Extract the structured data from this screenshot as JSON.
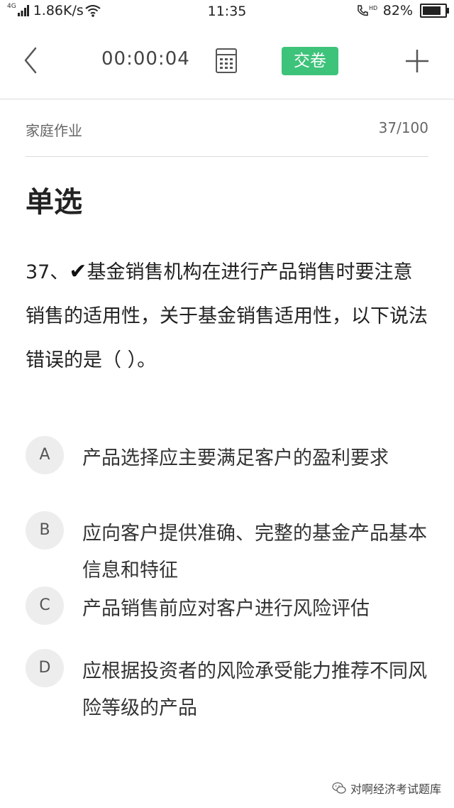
{
  "status_bar": {
    "network": "4G",
    "speed": "1.86K/s",
    "time": "11:35",
    "hd": "HD",
    "battery_text": "82%",
    "battery_level": 0.82
  },
  "toolbar": {
    "timer": "00:00:04",
    "submit_label": "交卷",
    "accent_color": "#3ec37a"
  },
  "sub_header": {
    "section_name": "家庭作业",
    "progress": "37/100"
  },
  "question": {
    "type": "单选",
    "number": "37、",
    "mark": "✔",
    "text": "基金销售机构在进行产品销售时要注意销售的适用性，关于基金销售适用性，以下说法错误的是（ ）。"
  },
  "options": [
    {
      "letter": "A",
      "text": "产品选择应主要满足客户的盈利要求"
    },
    {
      "letter": "B",
      "text": "应向客户提供准确、完整的基金产品基本信息和特征"
    },
    {
      "letter": "C",
      "text": "产品销售前应对客户进行风险评估"
    },
    {
      "letter": "D",
      "text": "应根据投资者的风险承受能力推荐不同风险等级的产品"
    }
  ],
  "watermark": {
    "text": "对啊经济考试题库"
  }
}
